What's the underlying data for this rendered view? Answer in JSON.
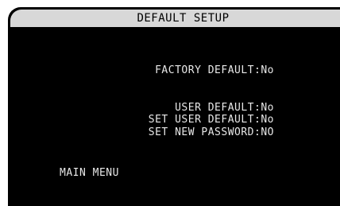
{
  "title": "DEFAULT SETUP",
  "items": [
    {
      "label": "FACTORY DEFAULT:",
      "value": "No"
    },
    {
      "label": "USER DEFAULT:",
      "value": "No"
    },
    {
      "label": "SET USER DEFAULT:",
      "value": "No"
    },
    {
      "label": "SET NEW PASSWORD:",
      "value": "NO"
    }
  ],
  "main_menu": "MAIN MENU",
  "colors": {
    "background": "#000000",
    "titlebar": "#d8d8d8",
    "text": "#e8e8e8"
  }
}
